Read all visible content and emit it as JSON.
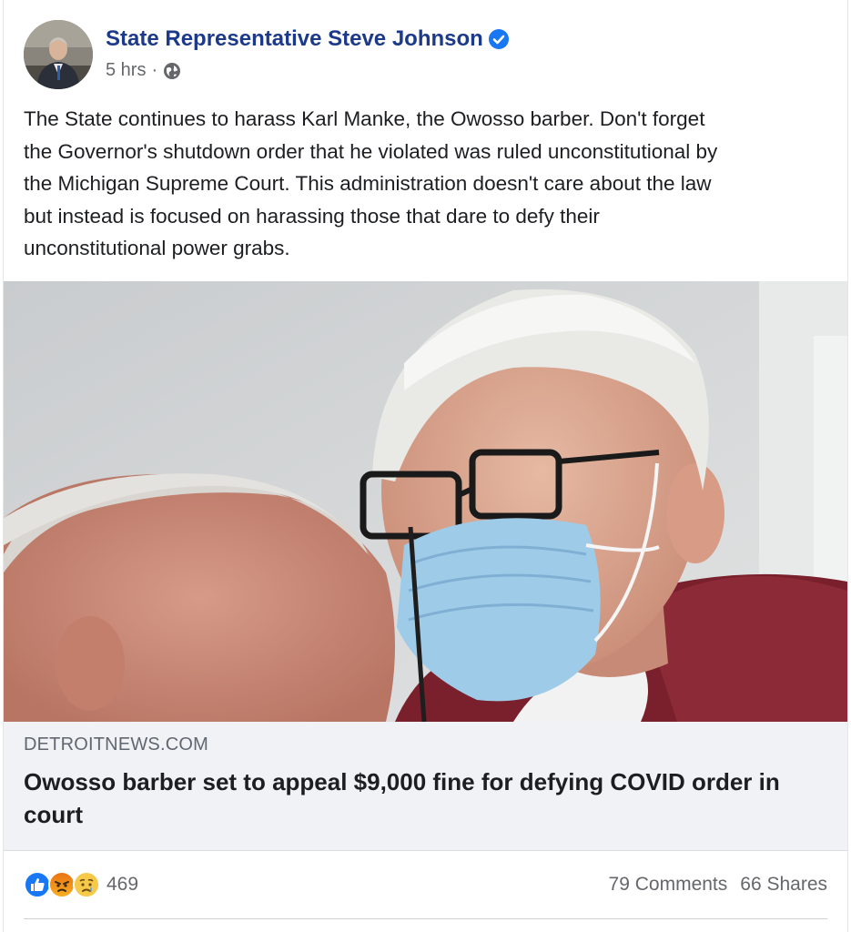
{
  "post": {
    "author": "State Representative Steve Johnson",
    "time": "5 hrs",
    "separator": "·",
    "text_lines": [
      "The State continues to harass Karl Manke, the Owosso barber. Don't forget",
      "the Governor's shutdown order that he violated was ruled unconstitutional by",
      "the Michigan Supreme Court. This administration doesn't care about the law",
      "but instead is focused on harassing those that dare to defy their",
      "unconstitutional power grabs."
    ]
  },
  "link": {
    "domain": "DETROITNEWS.COM",
    "title": "Owosso barber set to appeal $9,000 fine for defying COVID order in court"
  },
  "reactions": {
    "icons": [
      "like-icon",
      "angry-icon",
      "sad-icon"
    ],
    "count": "469"
  },
  "engagement": {
    "comments": "79 Comments",
    "shares": "66 Shares"
  },
  "colors": {
    "author_name": "#1d3a8a",
    "verified": "#1877f2",
    "link_box_bg": "#f0f2f5",
    "mask": "#9ecbe8",
    "jacket": "#7a1f2c"
  }
}
